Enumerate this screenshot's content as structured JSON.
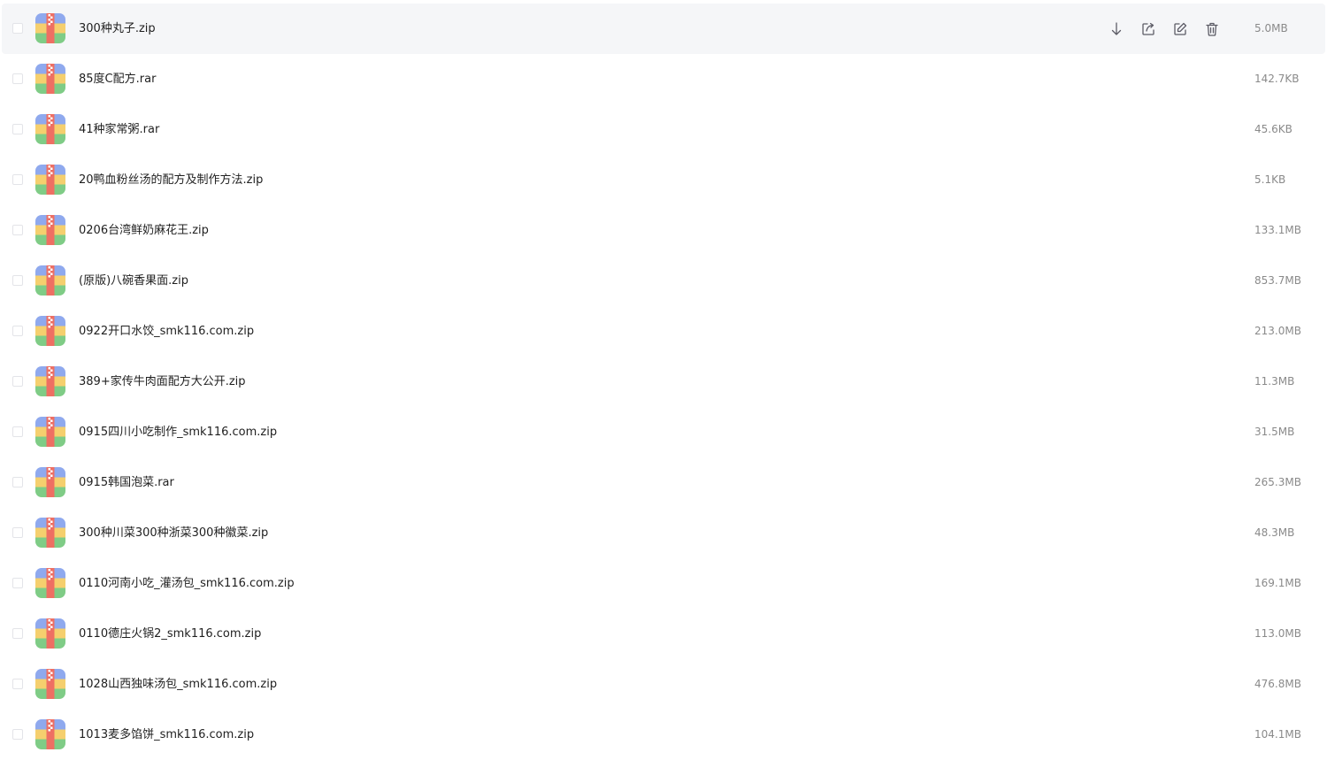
{
  "files": [
    {
      "name": "300种丸子.zip",
      "size": "5.0MB"
    },
    {
      "name": "85度C配方.rar",
      "size": "142.7KB"
    },
    {
      "name": "41种家常粥.rar",
      "size": "45.6KB"
    },
    {
      "name": "20鸭血粉丝汤的配方及制作方法.zip",
      "size": "5.1KB"
    },
    {
      "name": "0206台湾鲜奶麻花王.zip",
      "size": "133.1MB"
    },
    {
      "name": "(原版)八碗香果面.zip",
      "size": "853.7MB"
    },
    {
      "name": "0922开口水饺_smk116.com.zip",
      "size": "213.0MB"
    },
    {
      "name": "389+家传牛肉面配方大公开.zip",
      "size": "11.3MB"
    },
    {
      "name": "0915四川小吃制作_smk116.com.zip",
      "size": "31.5MB"
    },
    {
      "name": "0915韩国泡菜.rar",
      "size": "265.3MB"
    },
    {
      "name": "300种川菜300种浙菜300种徽菜.zip",
      "size": "48.3MB"
    },
    {
      "name": "0110河南小吃_灌汤包_smk116.com.zip",
      "size": "169.1MB"
    },
    {
      "name": "0110德庄火锅2_smk116.com.zip",
      "size": "113.0MB"
    },
    {
      "name": "1028山西独味汤包_smk116.com.zip",
      "size": "476.8MB"
    },
    {
      "name": "1013麦多馅饼_smk116.com.zip",
      "size": "104.1MB"
    }
  ],
  "hovered_row": 0,
  "row_actions": [
    "download-icon",
    "share-icon",
    "rename-icon",
    "delete-icon"
  ],
  "colors": {
    "hover_bg": "#f5f6f8",
    "icon_stroke": "#5c5c66",
    "size_text": "#8a8a8a"
  }
}
